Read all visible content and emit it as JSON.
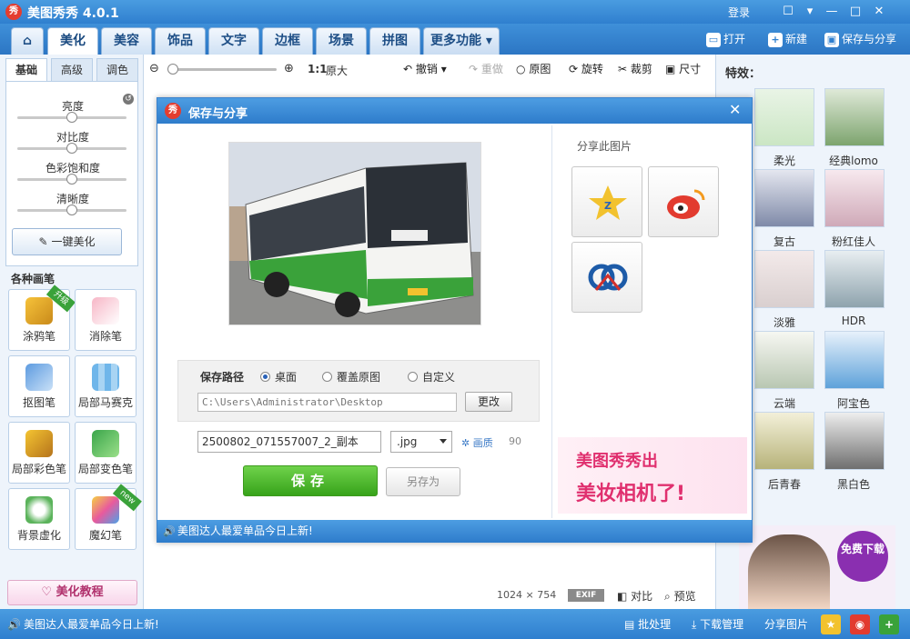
{
  "app": {
    "title": "美图秀秀 4.0.1",
    "logo_text": "秀",
    "login": "登录"
  },
  "window_controls": {
    "icons": [
      "chat-icon",
      "menu-icon",
      "minimize-icon",
      "maximize-icon",
      "close-icon"
    ]
  },
  "nav": {
    "tabs": [
      {
        "label": "",
        "icon": "home-icon"
      },
      {
        "label": "美化"
      },
      {
        "label": "美容"
      },
      {
        "label": "饰品"
      },
      {
        "label": "文字"
      },
      {
        "label": "边框"
      },
      {
        "label": "场景"
      },
      {
        "label": "拼图"
      },
      {
        "label": "更多功能"
      }
    ],
    "actions": {
      "open": "打开",
      "new": "新建",
      "save_share": "保存与分享"
    }
  },
  "left": {
    "subtabs": [
      "基础",
      "高级",
      "调色"
    ],
    "sliders": [
      {
        "label": "亮度",
        "value": 0.5
      },
      {
        "label": "对比度",
        "value": 0.5
      },
      {
        "label": "色彩饱和度",
        "value": 0.5
      },
      {
        "label": "清晰度",
        "value": 0.5
      }
    ],
    "one_key": "一键美化",
    "brush_header": "各种画笔",
    "tools": [
      {
        "label": "涂鸦笔",
        "badge": "升级"
      },
      {
        "label": "消除笔",
        "badge": ""
      },
      {
        "label": "抠图笔",
        "badge": ""
      },
      {
        "label": "局部马赛克",
        "badge": ""
      },
      {
        "label": "局部彩色笔",
        "badge": ""
      },
      {
        "label": "局部变色笔",
        "badge": ""
      },
      {
        "label": "背景虚化",
        "badge": ""
      },
      {
        "label": "魔幻笔",
        "badge": "new"
      }
    ],
    "tutorial": "美化教程"
  },
  "toolbar": {
    "ratio": "1:1",
    "original_size": "原大",
    "undo": "撤销",
    "redo": "重做",
    "original": "原图",
    "rotate": "旋转",
    "crop": "裁剪",
    "size": "尺寸"
  },
  "effects": {
    "header": "特效：",
    "items": [
      "柔光",
      "经典lomo",
      "复古",
      "粉红佳人",
      "淡雅",
      "HDR",
      "云端",
      "阿宝色",
      "后青春",
      "黑白色"
    ]
  },
  "dialog": {
    "title": "保存与分享",
    "logo_text": "秀",
    "path_label": "保存路径",
    "options": [
      {
        "label": "桌面",
        "selected": true
      },
      {
        "label": "覆盖原图",
        "selected": false
      },
      {
        "label": "自定义",
        "selected": false
      }
    ],
    "path_value": "C:\\Users\\Administrator\\Desktop",
    "change": "更改",
    "filename": "2500802_071557007_2_副本",
    "filetype": ".jpg",
    "quality_label": "画质",
    "quality_value": "90",
    "save": "保存",
    "save_as": "另存为",
    "share_header": "分享此图片",
    "share_icons": [
      "qzone-icon",
      "weibo-icon",
      "renren-icon"
    ],
    "ad_line1": "美图秀秀出",
    "ad_line2": "美妆相机了!",
    "status": "美图达人最爱单品今日上新!"
  },
  "canvas_info": {
    "width": "1024",
    "x": "×",
    "height": "754",
    "exif": "EXIF",
    "compare": "对比",
    "preview": "预览"
  },
  "download_ad": {
    "label": "免费下载"
  },
  "statusbar": {
    "message": "美图达人最爱单品今日上新!",
    "batch": "批处理",
    "download_mgr": "下载管理",
    "share_pic": "分享图片"
  },
  "colors": {
    "accent": "#2f7fcf",
    "save_green": "#37a31a",
    "ad_pink": "#e0306f"
  }
}
